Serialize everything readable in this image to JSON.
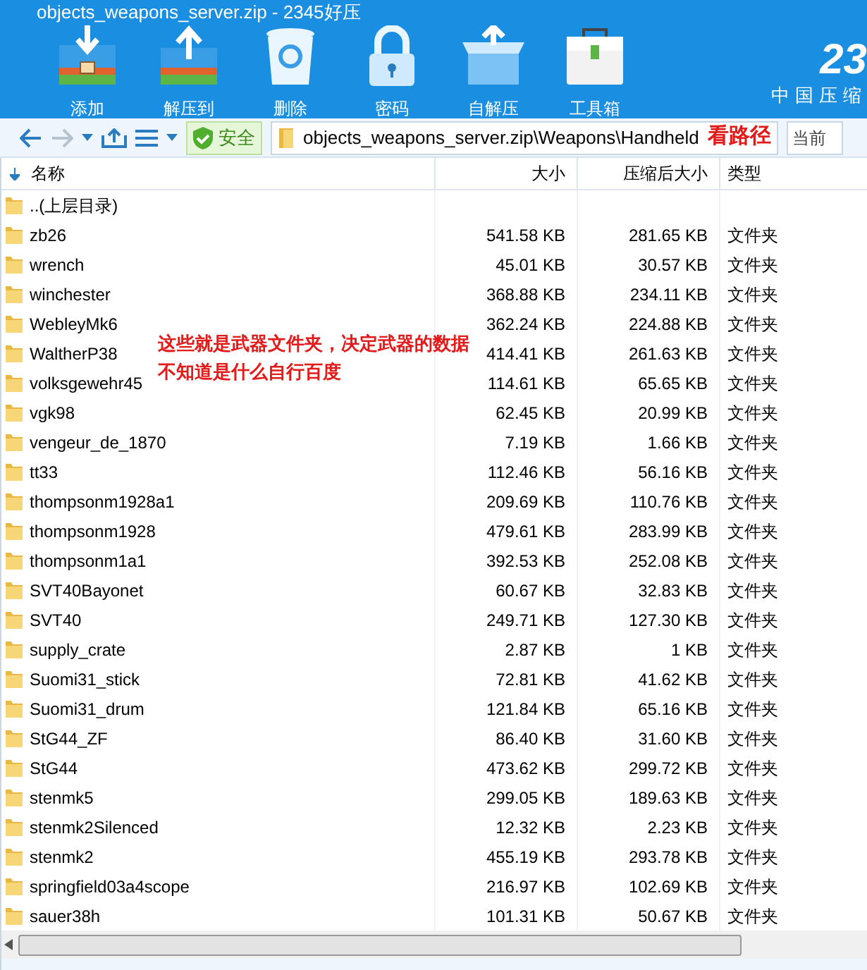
{
  "window": {
    "title": "objects_weapons_server.zip - 2345好压"
  },
  "toolbar": [
    {
      "label": "添加",
      "kind": "add"
    },
    {
      "label": "解压到",
      "kind": "extract"
    },
    {
      "label": "删除",
      "kind": "delete"
    },
    {
      "label": "密码",
      "kind": "lock"
    },
    {
      "label": "自解压",
      "kind": "sfx"
    },
    {
      "label": "工具箱",
      "kind": "tools"
    }
  ],
  "brand": {
    "logo": "23",
    "slogan": "中国压缩"
  },
  "address_bar": {
    "security": "安全",
    "path": "objects_weapons_server.zip\\Weapons\\Handheld",
    "note": "看路径",
    "search_placeholder": "当前"
  },
  "table": {
    "columns": [
      "名称",
      "大小",
      "压缩后大小",
      "类型"
    ],
    "rows": [
      {
        "name": "..(上层目录)",
        "size": "",
        "packed": "",
        "type": ""
      },
      {
        "name": "zb26",
        "size": "541.58 KB",
        "packed": "281.65 KB",
        "type": "文件夹"
      },
      {
        "name": "wrench",
        "size": "45.01 KB",
        "packed": "30.57 KB",
        "type": "文件夹"
      },
      {
        "name": "winchester",
        "size": "368.88 KB",
        "packed": "234.11 KB",
        "type": "文件夹"
      },
      {
        "name": "WebleyMk6",
        "size": "362.24 KB",
        "packed": "224.88 KB",
        "type": "文件夹"
      },
      {
        "name": "WaltherP38",
        "size": "414.41 KB",
        "packed": "261.63 KB",
        "type": "文件夹"
      },
      {
        "name": "volksgewehr45",
        "size": "114.61 KB",
        "packed": "65.65 KB",
        "type": "文件夹"
      },
      {
        "name": "vgk98",
        "size": "62.45 KB",
        "packed": "20.99 KB",
        "type": "文件夹"
      },
      {
        "name": "vengeur_de_1870",
        "size": "7.19 KB",
        "packed": "1.66 KB",
        "type": "文件夹"
      },
      {
        "name": "tt33",
        "size": "112.46 KB",
        "packed": "56.16 KB",
        "type": "文件夹"
      },
      {
        "name": "thompsonm1928a1",
        "size": "209.69 KB",
        "packed": "110.76 KB",
        "type": "文件夹"
      },
      {
        "name": "thompsonm1928",
        "size": "479.61 KB",
        "packed": "283.99 KB",
        "type": "文件夹"
      },
      {
        "name": "thompsonm1a1",
        "size": "392.53 KB",
        "packed": "252.08 KB",
        "type": "文件夹"
      },
      {
        "name": "SVT40Bayonet",
        "size": "60.67 KB",
        "packed": "32.83 KB",
        "type": "文件夹"
      },
      {
        "name": "SVT40",
        "size": "249.71 KB",
        "packed": "127.30 KB",
        "type": "文件夹"
      },
      {
        "name": "supply_crate",
        "size": "2.87 KB",
        "packed": "1 KB",
        "type": "文件夹"
      },
      {
        "name": "Suomi31_stick",
        "size": "72.81 KB",
        "packed": "41.62 KB",
        "type": "文件夹"
      },
      {
        "name": "Suomi31_drum",
        "size": "121.84 KB",
        "packed": "65.16 KB",
        "type": "文件夹"
      },
      {
        "name": "StG44_ZF",
        "size": "86.40 KB",
        "packed": "31.60 KB",
        "type": "文件夹"
      },
      {
        "name": "StG44",
        "size": "473.62 KB",
        "packed": "299.72 KB",
        "type": "文件夹"
      },
      {
        "name": "stenmk5",
        "size": "299.05 KB",
        "packed": "189.63 KB",
        "type": "文件夹"
      },
      {
        "name": "stenmk2Silenced",
        "size": "12.32 KB",
        "packed": "2.23 KB",
        "type": "文件夹"
      },
      {
        "name": "stenmk2",
        "size": "455.19 KB",
        "packed": "293.78 KB",
        "type": "文件夹"
      },
      {
        "name": "springfield03a4scope",
        "size": "216.97 KB",
        "packed": "102.69 KB",
        "type": "文件夹"
      },
      {
        "name": "sauer38h",
        "size": "101.31 KB",
        "packed": "50.67 KB",
        "type": "文件夹"
      }
    ]
  },
  "annotation": [
    "这些就是武器文件夹，决定武器的数据",
    "不知道是什么自行百度"
  ]
}
